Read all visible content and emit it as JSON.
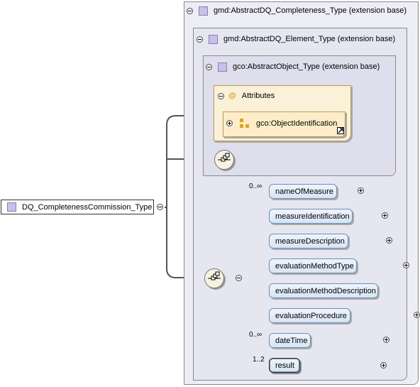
{
  "root": {
    "name": "DQ_CompletenessCommission_Type"
  },
  "extensions": [
    {
      "label": "gmd:AbstractDQ_Completeness_Type (extension base)"
    },
    {
      "label": "gmd:AbstractDQ_Element_Type (extension base)"
    },
    {
      "label": "gco:AbstractObject_Type (extension base)"
    }
  ],
  "attributes": {
    "label": "Attributes",
    "icon": "@",
    "group": "gco:ObjectIdentification"
  },
  "sequence_elements": [
    {
      "name": "nameOfMeasure",
      "occurs": "0..∞"
    },
    {
      "name": "measureIdentification",
      "occurs": ""
    },
    {
      "name": "measureDescription",
      "occurs": ""
    },
    {
      "name": "evaluationMethodType",
      "occurs": ""
    },
    {
      "name": "evaluationMethodDescription",
      "occurs": ""
    },
    {
      "name": "evaluationProcedure",
      "occurs": ""
    },
    {
      "name": "dateTime",
      "occurs": "0..∞"
    },
    {
      "name": "result",
      "occurs": "1..2"
    }
  ],
  "colors": {
    "type_icon": "#c9bfe8",
    "element_fill": "#dce8f6",
    "attribute_fill": "#fbf1d9"
  }
}
